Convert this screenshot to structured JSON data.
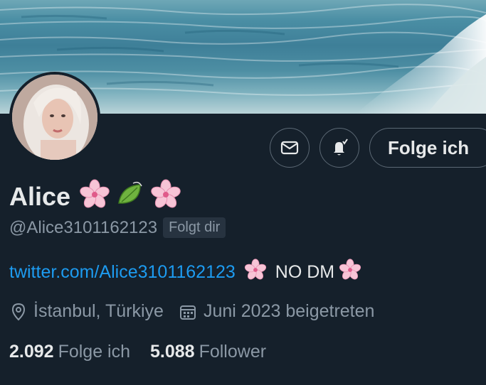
{
  "profile": {
    "display_name": "Alice",
    "name_emojis": [
      "cherry-blossom-icon",
      "leaf-icon",
      "cherry-blossom-icon"
    ],
    "handle": "@Alice3101162123",
    "follows_you_label": "Folgt dir",
    "bio": {
      "link": "twitter.com/Alice3101162123",
      "text": "NO DM"
    },
    "location": "İstanbul, Türkiye",
    "joined": "Juni 2023 beigetreten",
    "following_count": "2.092",
    "following_label": "Folge ich",
    "followers_count": "5.088",
    "followers_label": "Follower"
  },
  "actions": {
    "message_icon": "mail-icon",
    "notify_icon": "bell-check-icon",
    "follow_button_label": "Folge ich"
  },
  "colors": {
    "background": "#15202b",
    "text_primary": "#e7e9ea",
    "text_secondary": "#8b98a5",
    "link": "#1d9bf0",
    "border": "#5b6874"
  }
}
